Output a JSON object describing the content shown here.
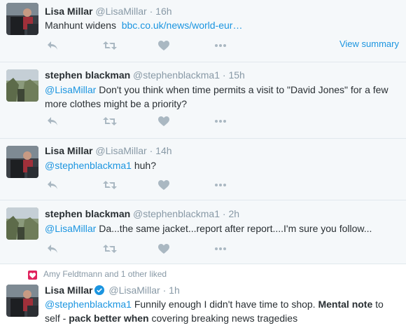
{
  "colors": {
    "link": "#1b95e0",
    "muted": "#8899a6",
    "thread_bg": "#f5f8fa",
    "like_red": "#e0245e"
  },
  "tweets": [
    {
      "name": "Lisa Millar",
      "handle": "@LisaMillar",
      "time": "16h",
      "text_prefix": "Manhunt widens",
      "link": "bbc.co.uk/news/world-eur…",
      "view_summary": "View summary"
    },
    {
      "name": "stephen blackman",
      "handle": "@stephenblackma1",
      "time": "15h",
      "mention": "@LisaMillar",
      "text_line1": " Don't you think when time permits a visit to \"David Jones\" for a few",
      "text_line2": "more clothes might be a priority?"
    },
    {
      "name": "Lisa Millar",
      "handle": "@LisaMillar",
      "time": "14h",
      "mention": "@stephenblackma1",
      "text": " huh?"
    },
    {
      "name": "stephen blackman",
      "handle": "@stephenblackma1",
      "time": "2h",
      "mention": "@LisaMillar",
      "text": " Da...the same jacket...report after report....I'm sure you follow..."
    },
    {
      "liked_by": "Amy Feldtmann and 1 other liked",
      "name": "Lisa Millar",
      "handle": "@LisaMillar",
      "time": "1h",
      "mention": "@stephenblackma1",
      "text_a": " Funnily enough I didn't have time to shop. ",
      "bold_a": "Mental note",
      "text_b": " to",
      "line2_a": "self - ",
      "bold_b": "pack better when",
      "line2_b": " covering breaking news tragedies"
    }
  ],
  "separator": "·",
  "icons": [
    "reply-icon",
    "retweet-icon",
    "like-icon",
    "more-icon",
    "verified-icon",
    "liked-heart-icon"
  ]
}
